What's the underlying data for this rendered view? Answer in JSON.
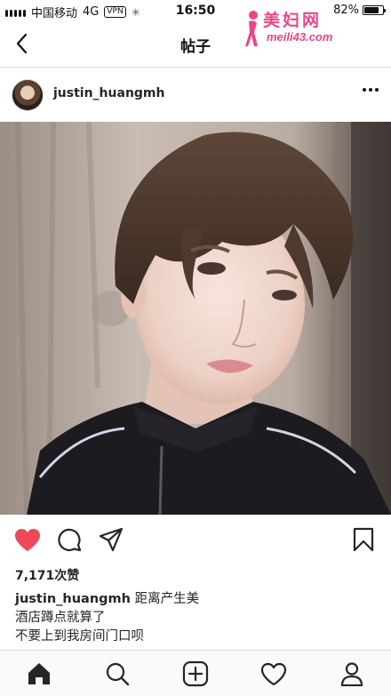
{
  "status_bar": {
    "carrier": "中国移动",
    "network": "4G",
    "vpn": "VPN",
    "time": "16:50",
    "battery_text": "82%",
    "battery_level": 0.82
  },
  "watermark": {
    "title": "美妇网",
    "url": "meili43.com"
  },
  "nav": {
    "title": "帖子"
  },
  "post": {
    "username": "justin_huangmh",
    "likes": "7,171次赞",
    "caption_user": "justin_huangmh",
    "caption_lines": [
      "距离产生美",
      "酒店蹲点就算了",
      "不要上到我房间门口呗"
    ],
    "liked": true
  },
  "colors": {
    "like_red": "#ed4956",
    "watermark_pink": "#e8478b",
    "border": "#dbdbdb"
  },
  "icons": {
    "back": "chevron-left-icon",
    "more": "more-horizontal-icon",
    "like": "heart-filled-icon",
    "comment": "comment-icon",
    "share": "paper-plane-icon",
    "save": "bookmark-icon",
    "home": "home-icon",
    "search": "search-icon",
    "add": "plus-square-icon",
    "activity": "heart-outline-icon",
    "profile": "user-icon"
  }
}
